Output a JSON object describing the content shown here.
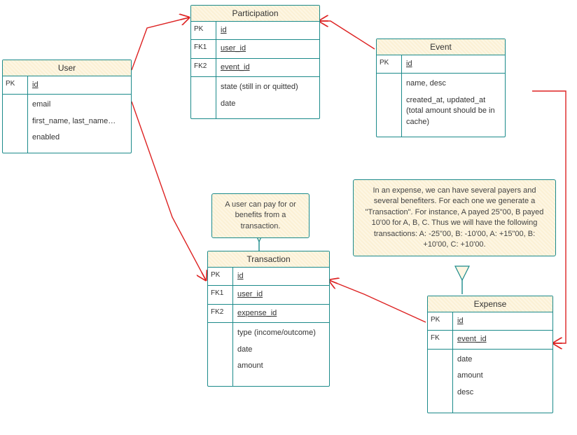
{
  "diagram": {
    "entities": {
      "user": {
        "title": "User",
        "keys": [
          {
            "k": "PK",
            "v": "id",
            "u": true
          }
        ],
        "attrs": [
          "email",
          "first_name, last_name…",
          "enabled"
        ]
      },
      "participation": {
        "title": "Participation",
        "keys": [
          {
            "k": "PK",
            "v": "id",
            "u": true
          },
          {
            "k": "FK1",
            "v": "user_id",
            "u": true
          },
          {
            "k": "FK2",
            "v": "event_id",
            "u": true
          }
        ],
        "attrs": [
          "state (still in or quitted)",
          "date"
        ]
      },
      "event": {
        "title": "Event",
        "keys": [
          {
            "k": "PK",
            "v": "id",
            "u": true
          }
        ],
        "attrs": [
          "name, desc",
          "created_at, updated_at",
          "(total amount should be in cache)"
        ]
      },
      "transaction": {
        "title": "Transaction",
        "keys": [
          {
            "k": "PK",
            "v": "id",
            "u": true
          },
          {
            "k": "FK1",
            "v": "user_id",
            "u": true
          },
          {
            "k": "FK2",
            "v": "expense_id",
            "u": true
          }
        ],
        "attrs": [
          "type (income/outcome)",
          "date",
          "amount"
        ]
      },
      "expense": {
        "title": "Expense",
        "keys": [
          {
            "k": "PK",
            "v": "id",
            "u": true
          },
          {
            "k": "FK",
            "v": "event_id",
            "u": true
          }
        ],
        "attrs": [
          "date",
          "amount",
          "desc"
        ]
      }
    },
    "notes": {
      "n1": "A user can pay for or benefits from a transaction.",
      "n2": "In an expense, we can have several payers and several benefiters. For each one we generate a \"Transaction\". For instance, A payed 25\"00, B payed 10'00 for A, B, C. Thus we will have the following transactions: A: -25\"00, B: -10'00, A: +15\"00, B: +10'00, C: +10'00."
    }
  },
  "chart_data": {
    "type": "erd",
    "entities": [
      {
        "name": "User",
        "pk": [
          "id"
        ],
        "attrs": [
          "email",
          "first_name",
          "last_name",
          "enabled"
        ]
      },
      {
        "name": "Participation",
        "pk": [
          "id"
        ],
        "fks": [
          "user_id",
          "event_id"
        ],
        "attrs": [
          "state",
          "date"
        ]
      },
      {
        "name": "Event",
        "pk": [
          "id"
        ],
        "attrs": [
          "name",
          "desc",
          "created_at",
          "updated_at"
        ]
      },
      {
        "name": "Transaction",
        "pk": [
          "id"
        ],
        "fks": [
          "user_id",
          "expense_id"
        ],
        "attrs": [
          "type",
          "date",
          "amount"
        ]
      },
      {
        "name": "Expense",
        "pk": [
          "id"
        ],
        "fks": [
          "event_id"
        ],
        "attrs": [
          "date",
          "amount",
          "desc"
        ]
      }
    ],
    "relationships": [
      {
        "from": "User",
        "to": "Participation",
        "via": "user_id",
        "cardinality": "1:N"
      },
      {
        "from": "Event",
        "to": "Participation",
        "via": "event_id",
        "cardinality": "1:N"
      },
      {
        "from": "User",
        "to": "Transaction",
        "via": "user_id",
        "cardinality": "1:N"
      },
      {
        "from": "Expense",
        "to": "Transaction",
        "via": "expense_id",
        "cardinality": "1:N"
      },
      {
        "from": "Event",
        "to": "Expense",
        "via": "event_id",
        "cardinality": "1:N"
      }
    ],
    "notes": [
      "A user can pay for or benefits from a transaction.",
      "In an expense, we can have several payers and several benefiters. For each one we generate a Transaction."
    ]
  }
}
